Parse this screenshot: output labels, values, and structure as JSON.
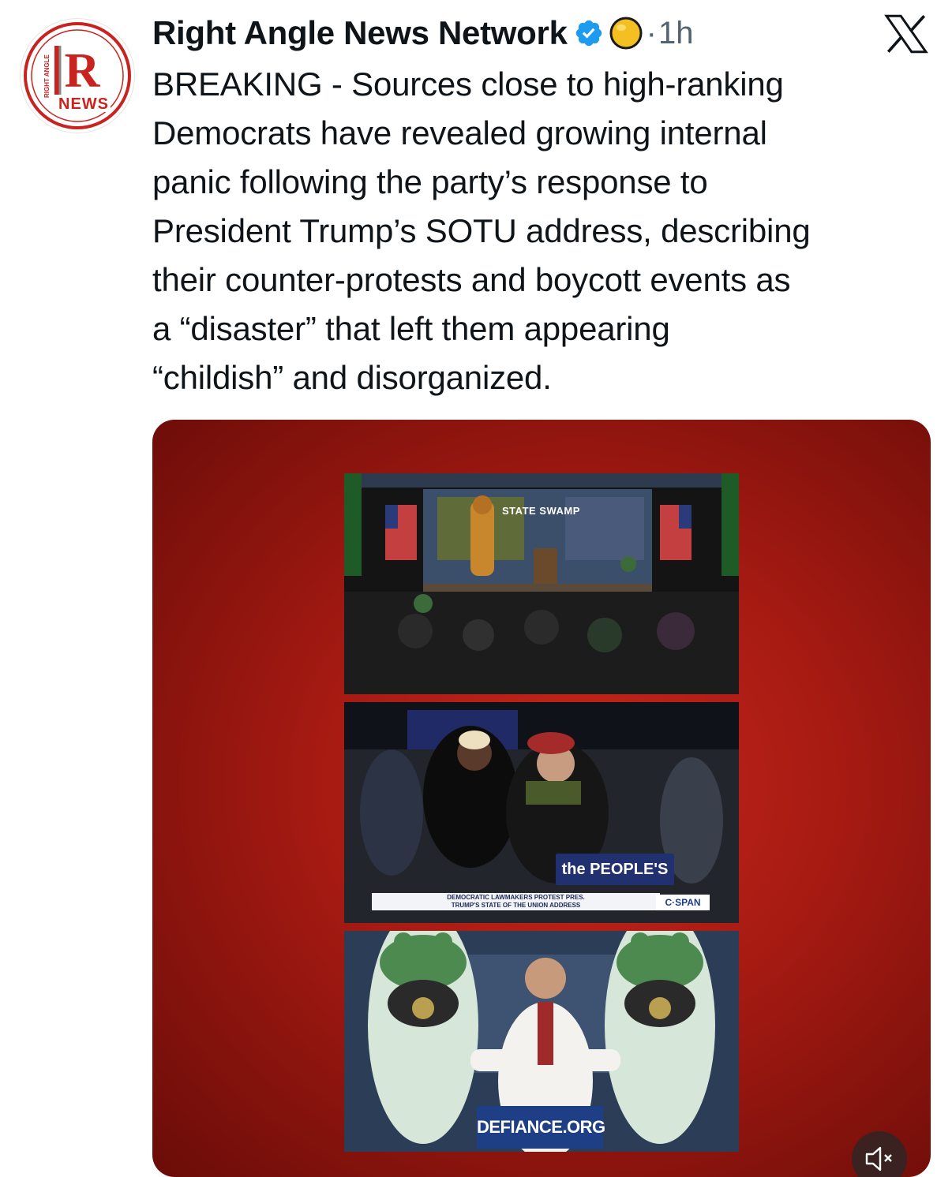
{
  "author": {
    "display_name": "Right Angle News Network",
    "avatar": {
      "logo_letter": "R",
      "logo_wordmark": "NEWS",
      "logo_ring_text": "RIGHT ANGLE",
      "brand_color": "#c8231f"
    },
    "verified_icon": "verified-badge-icon",
    "emoji_icon": "yellow-circle-emoji",
    "separator": "·",
    "timestamp": "1h"
  },
  "platform": {
    "logo_icon": "x-logo-icon"
  },
  "tweet": {
    "text": "BREAKING - Sources close to high-ranking\nDemocrats have revealed growing internal\npanic following the party’s response to\nPresident Trump’s SOTU address, describing\ntheir counter-protests and boycott events as\na “disaster” that left them appearing\n“childish” and disorganized."
  },
  "media": {
    "background_color": "#a41a12",
    "panels": [
      {
        "sign_text": "STATE SWAMP"
      },
      {
        "sign_text": "the PEOPLE'S",
        "caption": "DEMOCRATIC LAWMAKERS PROTEST PRES.\nTRUMP'S STATE OF THE UNION ADDRESS",
        "network": "C·SPAN"
      },
      {
        "sign_text": "DEFIANCE.ORG"
      }
    ],
    "mute_icon": "speaker-muted-icon"
  }
}
